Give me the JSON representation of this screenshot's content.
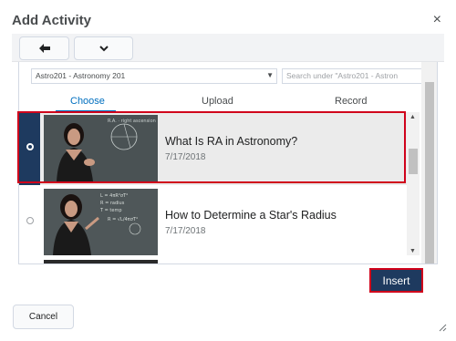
{
  "dialog": {
    "title": "Add Activity",
    "close_icon": "×"
  },
  "toolbar": {
    "back_icon": "arrow-left-icon",
    "more_icon": "chevron-down-icon"
  },
  "filters": {
    "course_select": "Astro201 - Astronomy 201",
    "search_placeholder": "Search under \"Astro201 - Astron"
  },
  "tabs": [
    {
      "label": "Choose",
      "active": true
    },
    {
      "label": "Upload",
      "active": false
    },
    {
      "label": "Record",
      "active": false
    }
  ],
  "items": [
    {
      "title": "What Is RA in Astronomy?",
      "date": "7/17/2018",
      "selected": true
    },
    {
      "title": "How to Determine a Star's Radius",
      "date": "7/17/2018",
      "selected": false
    }
  ],
  "actions": {
    "insert_label": "Insert",
    "cancel_label": "Cancel"
  },
  "colors": {
    "primary": "#1e3a5f",
    "highlight": "#d0021b",
    "link": "#006fbf"
  }
}
